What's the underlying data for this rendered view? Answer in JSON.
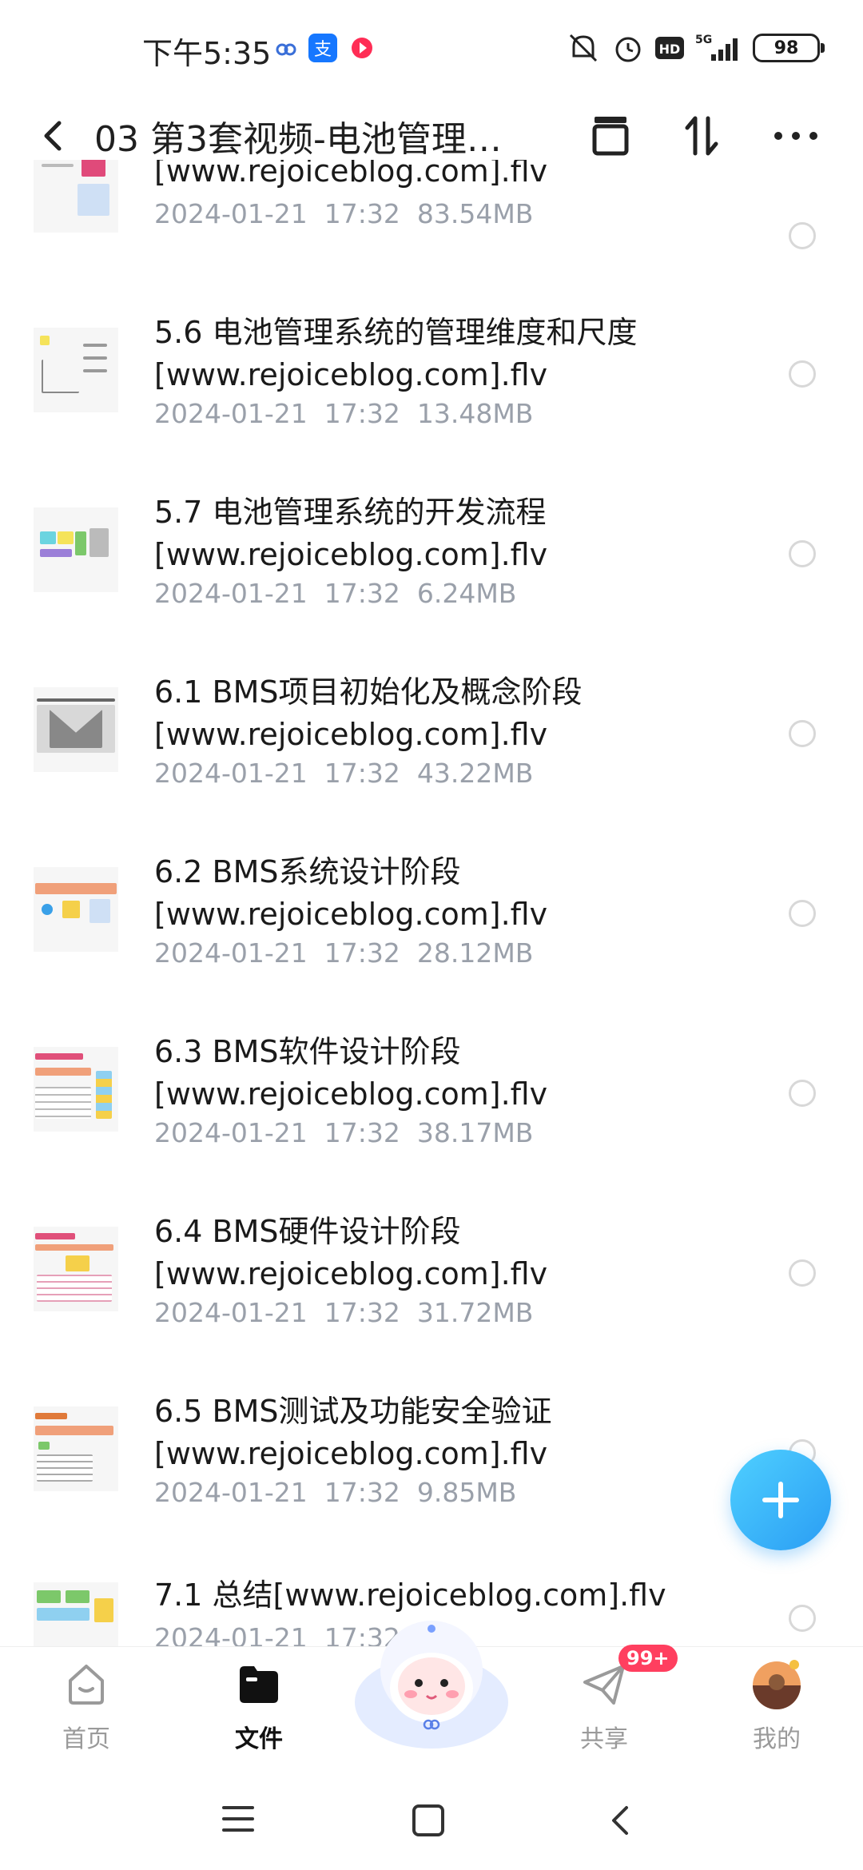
{
  "status_bar": {
    "time": "下午5:35",
    "battery": "98",
    "network": "5G"
  },
  "header": {
    "title": "03 第3套视频-电池管理…",
    "icons": [
      "back-icon",
      "archive-icon",
      "sort-icon",
      "more-icon"
    ]
  },
  "files": [
    {
      "name": "[www.rejoiceblog.com].flv",
      "date": "2024-01-21",
      "time": "17:32",
      "size": "83.54MB"
    },
    {
      "name": "5.6 电池管理系统的管理维度和尺度 [www.rejoiceblog.com].flv",
      "date": "2024-01-21",
      "time": "17:32",
      "size": "13.48MB"
    },
    {
      "name": "5.7 电池管理系统的开发流程 [www.rejoiceblog.com].flv",
      "date": "2024-01-21",
      "time": "17:32",
      "size": "6.24MB"
    },
    {
      "name": "6.1 BMS项目初始化及概念阶段 [www.rejoiceblog.com].flv",
      "date": "2024-01-21",
      "time": "17:32",
      "size": "43.22MB"
    },
    {
      "name": "6.2 BMS系统设计阶段 [www.rejoiceblog.com].flv",
      "date": "2024-01-21",
      "time": "17:32",
      "size": "28.12MB"
    },
    {
      "name": "6.3 BMS软件设计阶段 [www.rejoiceblog.com].flv",
      "date": "2024-01-21",
      "time": "17:32",
      "size": "38.17MB"
    },
    {
      "name": "6.4 BMS硬件设计阶段 [www.rejoiceblog.com].flv",
      "date": "2024-01-21",
      "time": "17:32",
      "size": "31.72MB"
    },
    {
      "name": "6.5 BMS测试及功能安全验证 [www.rejoiceblog.com].flv",
      "date": "2024-01-21",
      "time": "17:32",
      "size": "9.85MB"
    },
    {
      "name": "7.1 总结[www.rejoiceblog.com].flv",
      "date": "2024-01-21",
      "time": "17:32",
      "size": ""
    }
  ],
  "bottom_nav": {
    "items": [
      {
        "label": "首页",
        "icon": "home-icon"
      },
      {
        "label": "文件",
        "icon": "folder-icon"
      },
      {
        "label": "",
        "icon": "mascot-icon"
      },
      {
        "label": "共享",
        "icon": "share-icon"
      },
      {
        "label": "我的",
        "icon": "avatar-icon"
      }
    ],
    "share_badge": "99+"
  },
  "colors": {
    "accent": "#2a9df4",
    "badge": "#ff3f5f",
    "meta_text": "#9aa0aa"
  }
}
